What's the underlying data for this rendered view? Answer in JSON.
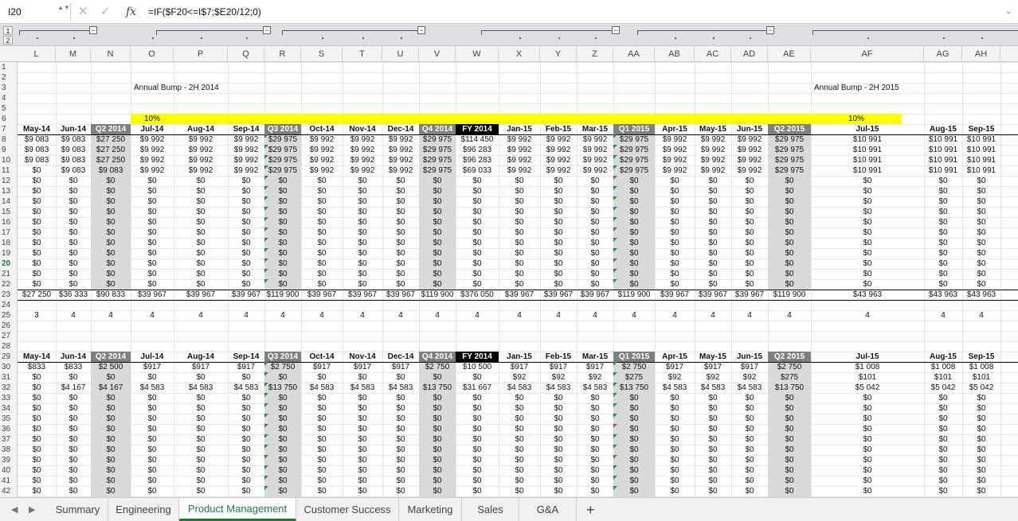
{
  "formula_bar": {
    "name_box": "I20",
    "spin": "▲▼",
    "cancel_icon": "✕",
    "confirm_icon": "✓",
    "fx_label": "fx",
    "formula": "=IF($F20<=I$7;$E20/12;0)",
    "chevron": "⌄"
  },
  "outline": {
    "levels": [
      "1",
      "2"
    ],
    "collapse_symbol": "−"
  },
  "columns": [
    "L",
    "M",
    "N",
    "O",
    "P",
    "Q",
    "R",
    "S",
    "T",
    "U",
    "V",
    "W",
    "X",
    "Y",
    "Z",
    "AA",
    "AB",
    "AC",
    "AD",
    "AE",
    "AF",
    "AG",
    "AH"
  ],
  "rows": [
    "1",
    "2",
    "3",
    "4",
    "5",
    "6",
    "7",
    "8",
    "9",
    "10",
    "11",
    "12",
    "13",
    "14",
    "15",
    "16",
    "17",
    "18",
    "19",
    "20",
    "21",
    "22",
    "23",
    "24",
    "25",
    "26",
    "27",
    "28",
    "29",
    "30",
    "31",
    "32",
    "33",
    "34",
    "35",
    "36",
    "37",
    "38",
    "39",
    "40",
    "41",
    "42"
  ],
  "selected_row": "20",
  "annotations": {
    "bump_2014": "Annual Bump - 2H 2014",
    "bump_2015": "Annual Bump - 2H 2015",
    "pct_2014": "10%",
    "pct_2015": "10%"
  },
  "headers": [
    "May-14",
    "Jun-14",
    "Q2 2014",
    "Jul-14",
    "Aug-14",
    "Sep-14",
    "Q3 2014",
    "Oct-14",
    "Nov-14",
    "Dec-14",
    "Q4 2014",
    "FY 2014",
    "Jan-15",
    "Feb-15",
    "Mar-15",
    "Q1 2015",
    "Apr-15",
    "May-15",
    "Jun-15",
    "Q2 2015",
    "Jul-15",
    "Aug-15",
    "Sep-15"
  ],
  "block1": {
    "r8": [
      "$9 083",
      "$9 083",
      "$27 250",
      "$9 992",
      "$9 992",
      "$9 992",
      "$29 975",
      "$9 992",
      "$9 992",
      "$9 992",
      "$29 975",
      "$114 450",
      "$9 992",
      "$9 992",
      "$9 992",
      "$29 975",
      "$9 992",
      "$9 992",
      "$9 992",
      "$29 975",
      "$10 991",
      "$10 991",
      "$10 991"
    ],
    "r9": [
      "$9 083",
      "$9 083",
      "$27 250",
      "$9 992",
      "$9 992",
      "$9 992",
      "$29 975",
      "$9 992",
      "$9 992",
      "$9 992",
      "$29 975",
      "$96 283",
      "$9 992",
      "$9 992",
      "$9 992",
      "$29 975",
      "$9 992",
      "$9 992",
      "$9 992",
      "$29 975",
      "$10 991",
      "$10 991",
      "$10 991"
    ],
    "r10": [
      "$9 083",
      "$9 083",
      "$27 250",
      "$9 992",
      "$9 992",
      "$9 992",
      "$29 975",
      "$9 992",
      "$9 992",
      "$9 992",
      "$29 975",
      "$96 283",
      "$9 992",
      "$9 992",
      "$9 992",
      "$29 975",
      "$9 992",
      "$9 992",
      "$9 992",
      "$29 975",
      "$10 991",
      "$10 991",
      "$10 991"
    ],
    "r11": [
      "$0",
      "$9 083",
      "$9 083",
      "$9 992",
      "$9 992",
      "$9 992",
      "$29 975",
      "$9 992",
      "$9 992",
      "$9 992",
      "$29 975",
      "$69 033",
      "$9 992",
      "$9 992",
      "$9 992",
      "$29 975",
      "$9 992",
      "$9 992",
      "$9 992",
      "$29 975",
      "$10 991",
      "$10 991",
      "$10 991"
    ],
    "zero": "$0",
    "total": [
      "$27 250",
      "$36 333",
      "$90 833",
      "$39 967",
      "$39 967",
      "$39 967",
      "$119 900",
      "$39 967",
      "$39 967",
      "$39 967",
      "$119 900",
      "$376 050",
      "$39 967",
      "$39 967",
      "$39 967",
      "$119 900",
      "$39 967",
      "$39 967",
      "$39 967",
      "$119 900",
      "$43 963",
      "$43 963",
      "$43 963"
    ],
    "row25": [
      "3",
      "4",
      "4",
      "4",
      "4",
      "4",
      "4",
      "4",
      "4",
      "4",
      "4",
      "4",
      "4",
      "4",
      "4",
      "4",
      "4",
      "4",
      "4",
      "4",
      "4",
      "4",
      "4"
    ]
  },
  "block2": {
    "r30": [
      "$833",
      "$833",
      "$2 500",
      "$917",
      "$917",
      "$917",
      "$2 750",
      "$917",
      "$917",
      "$917",
      "$2 750",
      "$10 500",
      "$917",
      "$917",
      "$917",
      "$2 750",
      "$917",
      "$917",
      "$917",
      "$2 750",
      "$1 008",
      "$1 008",
      "$1 008"
    ],
    "r31": [
      "$0",
      "$0",
      "$0",
      "$0",
      "$0",
      "$0",
      "$0",
      "$0",
      "$0",
      "$0",
      "$0",
      "$0",
      "$92",
      "$92",
      "$92",
      "$275",
      "$92",
      "$92",
      "$92",
      "$275",
      "$101",
      "$101",
      "$101"
    ],
    "r32": [
      "$0",
      "$4 167",
      "$4 167",
      "$4 583",
      "$4 583",
      "$4 583",
      "$13 750",
      "$4 583",
      "$4 583",
      "$4 583",
      "$13 750",
      "$31 667",
      "$4 583",
      "$4 583",
      "$4 583",
      "$13 750",
      "$4 583",
      "$4 583",
      "$4 583",
      "$13 750",
      "$5 042",
      "$5 042",
      "$5 042"
    ],
    "zero": "$0"
  },
  "sheet_tabs": {
    "nav_prev": "◀",
    "nav_next": "▶",
    "items": [
      "Summary",
      "Engineering",
      "Product Management",
      "Customer Success",
      "Marketing",
      "Sales",
      "G&A"
    ],
    "active": "Product Management",
    "add": "+"
  },
  "colors": {
    "accent_green": "#1e7a3a",
    "highlight_yellow": "#ffff00",
    "quarter_band": "#d9d9d9",
    "quarter_header": "#808080"
  }
}
